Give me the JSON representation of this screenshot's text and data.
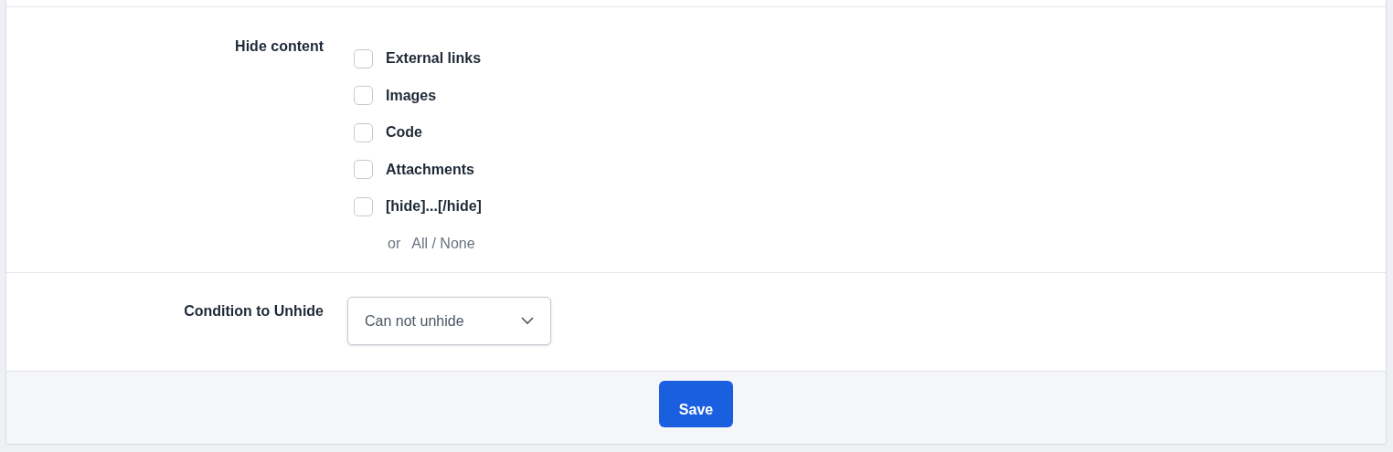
{
  "hide_content": {
    "label": "Hide content",
    "options": [
      {
        "label": "External links",
        "checked": false
      },
      {
        "label": "Images",
        "checked": false
      },
      {
        "label": "Code",
        "checked": false
      },
      {
        "label": "Attachments",
        "checked": false
      },
      {
        "label": "[hide]...[/hide]",
        "checked": false
      }
    ],
    "or": "or",
    "all_none": "All / None"
  },
  "condition": {
    "label": "Condition to Unhide",
    "value": "Can not unhide"
  },
  "save_button": "Save"
}
